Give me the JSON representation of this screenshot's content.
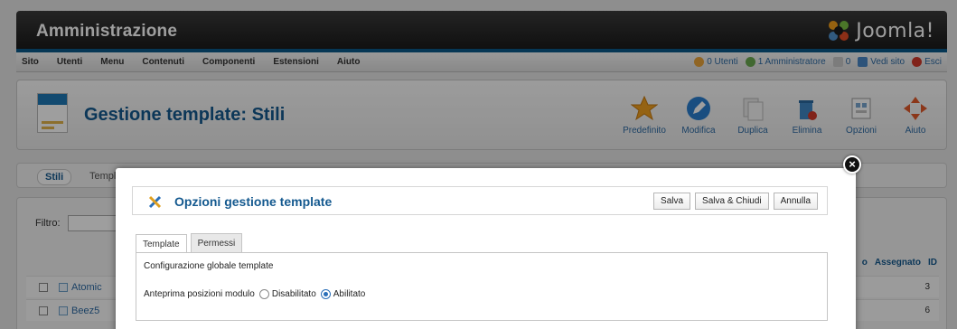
{
  "header": {
    "title": "Amministrazione",
    "logo_text": "Joomla!"
  },
  "menu": [
    "Sito",
    "Utenti",
    "Menu",
    "Contenuti",
    "Componenti",
    "Estensioni",
    "Aiuto"
  ],
  "status": {
    "users_online": "0 Utenti",
    "admins_online": "1 Amministratore",
    "messages": "0",
    "view_site": "Vedi sito",
    "logout": "Esci"
  },
  "toolbar": {
    "title": "Gestione template: Stili",
    "buttons": [
      {
        "label": "Predefinito",
        "icon": "star-icon"
      },
      {
        "label": "Modifica",
        "icon": "edit-icon"
      },
      {
        "label": "Duplica",
        "icon": "copy-icon"
      },
      {
        "label": "Elimina",
        "icon": "trash-icon"
      },
      {
        "label": "Opzioni",
        "icon": "options-icon"
      },
      {
        "label": "Aiuto",
        "icon": "help-icon"
      }
    ]
  },
  "subtabs": {
    "styles": "Stili",
    "templates": "Templa"
  },
  "main": {
    "filter_label": "Filtro:",
    "columns": {
      "assigned": "Assegnato",
      "id": "ID",
      "partial": "o"
    },
    "rows": [
      {
        "name": "Atomic",
        "id": "3"
      },
      {
        "name": "Beez5",
        "id": "6"
      }
    ]
  },
  "modal": {
    "title": "Opzioni gestione template",
    "actions": {
      "save": "Salva",
      "save_close": "Salva & Chiudi",
      "cancel": "Annulla"
    },
    "tabs": {
      "template": "Template",
      "permissions": "Permessi"
    },
    "panel_heading": "Configurazione globale template",
    "option": {
      "label": "Anteprima posizioni modulo",
      "disabled": "Disabilitato",
      "enabled": "Abilitato",
      "selected": "Abilitato"
    }
  }
}
